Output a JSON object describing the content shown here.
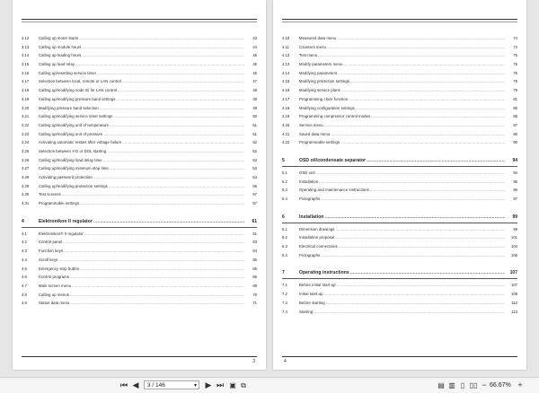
{
  "left_page": {
    "page_number": "3",
    "entries": [
      {
        "num": "3.12",
        "text": "Calling up motor starts",
        "page": "43"
      },
      {
        "num": "3.13",
        "text": "Calling up module hours",
        "page": "44"
      },
      {
        "num": "3.14",
        "text": "Calling up loading hours",
        "page": "45"
      },
      {
        "num": "3.15",
        "text": "Calling up load relay",
        "page": "45"
      },
      {
        "num": "3.16",
        "text": "Calling up/resetting service timer",
        "page": "46"
      },
      {
        "num": "3.17",
        "text": "Selection between local, remote or LAN control",
        "page": "47"
      },
      {
        "num": "3.18",
        "text": "Calling up/modifying node ID for LAN control",
        "page": "48"
      },
      {
        "num": "3.19",
        "text": "Calling up/modifying pressure band settings",
        "page": "48"
      },
      {
        "num": "3.20",
        "text": "Modifying pressure band selection",
        "page": "49"
      },
      {
        "num": "3.21",
        "text": "Calling up/modifying service timer settings",
        "page": "50"
      },
      {
        "num": "3.22",
        "text": "Calling up/modifying unit of temperature",
        "page": "51"
      },
      {
        "num": "3.23",
        "text": "Calling up/modifying unit of pressure",
        "page": "51"
      },
      {
        "num": "3.24",
        "text": "Activating automatic restart after voltage failure",
        "page": "52"
      },
      {
        "num": "3.25",
        "text": "Selection between Y-D or DOL starting",
        "page": "52"
      },
      {
        "num": "3.26",
        "text": "Calling up/modifying load delay time",
        "page": "53"
      },
      {
        "num": "3.27",
        "text": "Calling up/modifying minimum stop time",
        "page": "53"
      },
      {
        "num": "3.28",
        "text": "Activating password protection",
        "page": "54"
      },
      {
        "num": "3.29",
        "text": "Calling up/modifying protection settings",
        "page": "55"
      },
      {
        "num": "3.30",
        "text": "Test screens",
        "page": "57"
      },
      {
        "num": "3.31",
        "text": "Programmable settings",
        "page": "57"
      },
      {
        "num": "4",
        "text": "Elektronikon II regulator",
        "page": "61",
        "section": true
      },
      {
        "num": "4.1",
        "text": "Elektronikon® II regulator",
        "page": "61"
      },
      {
        "num": "4.2",
        "text": "Control panel",
        "page": "63"
      },
      {
        "num": "4.3",
        "text": "Function keys",
        "page": "64"
      },
      {
        "num": "4.4",
        "text": "Scroll keys",
        "page": "65"
      },
      {
        "num": "4.5",
        "text": "Emergency stop button",
        "page": "65"
      },
      {
        "num": "4.6",
        "text": "Control programs",
        "page": "66"
      },
      {
        "num": "4.7",
        "text": "Main screen menu",
        "page": "69"
      },
      {
        "num": "4.8",
        "text": "Calling up menus",
        "page": "70"
      },
      {
        "num": "4.9",
        "text": "Status data menu",
        "page": "71"
      }
    ]
  },
  "right_page": {
    "page_number": "4",
    "entries": [
      {
        "num": "4.10",
        "text": "Measured data menu",
        "page": "74"
      },
      {
        "num": "4.11",
        "text": "Counters menu",
        "page": "74"
      },
      {
        "num": "4.12",
        "text": "Test menu",
        "page": "75"
      },
      {
        "num": "4.13",
        "text": "Modify parameters menu",
        "page": "76"
      },
      {
        "num": "4.14",
        "text": "Modifying parameters",
        "page": "76"
      },
      {
        "num": "4.15",
        "text": "Modifying protection settings",
        "page": "78"
      },
      {
        "num": "4.16",
        "text": "Modifying service plans",
        "page": "79"
      },
      {
        "num": "4.17",
        "text": "Programming clock function",
        "page": "81"
      },
      {
        "num": "4.18",
        "text": "Modifying configuration settings",
        "page": "85"
      },
      {
        "num": "4.19",
        "text": "Programming compressor control modes",
        "page": "86"
      },
      {
        "num": "4.20",
        "text": "Service menu",
        "page": "87"
      },
      {
        "num": "4.21",
        "text": "Saved data menu",
        "page": "90"
      },
      {
        "num": "4.22",
        "text": "Programmable settings",
        "page": "90"
      },
      {
        "num": "5",
        "text": "OSD oil/condensate separator",
        "page": "94",
        "section": true
      },
      {
        "num": "5.1",
        "text": "OSD unit",
        "page": "94"
      },
      {
        "num": "5.2",
        "text": "Installation",
        "page": "95"
      },
      {
        "num": "5.3",
        "text": "Operating and maintenance instructions",
        "page": "96"
      },
      {
        "num": "5.4",
        "text": "Pictographs",
        "page": "97"
      },
      {
        "num": "6",
        "text": "Installation",
        "page": "99",
        "section": true
      },
      {
        "num": "6.1",
        "text": "Dimension drawings",
        "page": "99"
      },
      {
        "num": "6.2",
        "text": "Installation proposal",
        "page": "101"
      },
      {
        "num": "6.3",
        "text": "Electrical connections",
        "page": "104"
      },
      {
        "num": "6.4",
        "text": "Pictographs",
        "page": "106"
      },
      {
        "num": "7",
        "text": "Operating instructions",
        "page": "107",
        "section": true
      },
      {
        "num": "7.1",
        "text": "Before initial start-up",
        "page": "107"
      },
      {
        "num": "7.2",
        "text": "Initial start-up",
        "page": "108"
      },
      {
        "num": "7.3",
        "text": "Before starting",
        "page": "113"
      },
      {
        "num": "7.4",
        "text": "Starting",
        "page": "113"
      }
    ]
  },
  "toolbar": {
    "page_indicator": "3 / 146",
    "zoom": "66.67%",
    "icons": [
      "first-page-icon",
      "previous-page-icon",
      "next-page-icon",
      "last-page-icon",
      "page-view-icon",
      "copy-icon",
      "fit-page-icon",
      "fit-width-icon",
      "single-page-icon",
      "two-page-icon",
      "zoom-out-icon",
      "zoom-in-icon"
    ]
  }
}
